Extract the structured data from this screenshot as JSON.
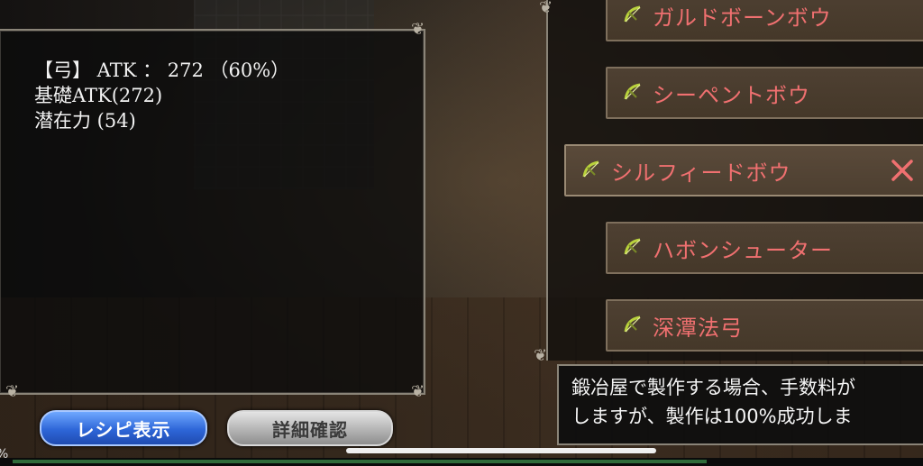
{
  "stats": {
    "line1": "【弓】 ATK ： 272 （60%）",
    "line2": "基礎ATK(272)",
    "line3": "潜在力 (54)"
  },
  "items": [
    {
      "name": "ガルドボーンボウ",
      "icon": "bow-icon"
    },
    {
      "name": "シーペントボウ",
      "icon": "bow-icon"
    },
    {
      "name": "シルフィードボウ",
      "icon": "bow-icon",
      "selected": true,
      "close_icon": "close-x-icon"
    },
    {
      "name": "ハボンシューター",
      "icon": "bow-icon"
    },
    {
      "name": "深潭法弓",
      "icon": "bow-icon"
    }
  ],
  "description": {
    "line1": "鍛冶屋で製作する場合、手数料が",
    "line2": "しますが、製作は100%成功しま"
  },
  "buttons": {
    "recipe": "レシピ表示",
    "detail": "詳細確認"
  },
  "edge_text": "%",
  "colors": {
    "item_text": "#f07070",
    "recipe_button": "#2e66d8",
    "detail_button": "#b4b4b4",
    "close_icon": "#f07070",
    "bow_icon": "#b9d23c"
  }
}
